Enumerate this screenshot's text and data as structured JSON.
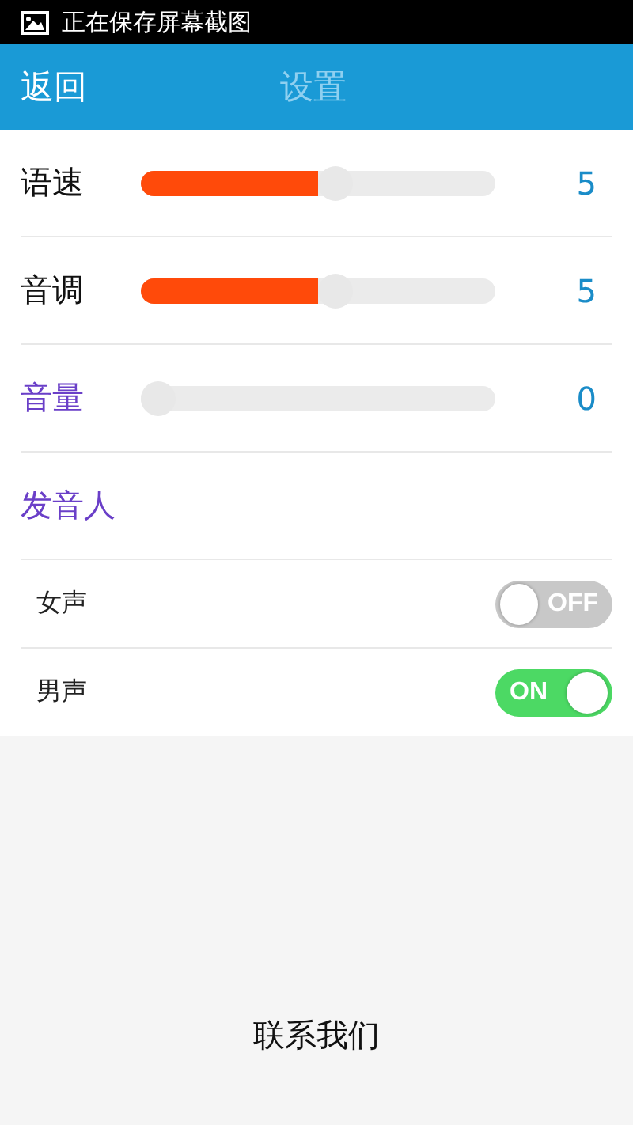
{
  "status_bar": {
    "notification": "正在保存屏幕截图"
  },
  "header": {
    "back": "返回",
    "title": "设置"
  },
  "sliders": [
    {
      "label": "语速",
      "highlighted": false,
      "level": 0.555,
      "reading": "5"
    },
    {
      "label": "音调",
      "highlighted": false,
      "level": 0.555,
      "reading": "5"
    },
    {
      "label": "音量",
      "highlighted": true,
      "level": 0,
      "reading": "0"
    }
  ],
  "speaker_section": {
    "title": "发音人",
    "options": [
      {
        "label": "女声",
        "on": false,
        "switch_text": "OFF"
      },
      {
        "label": "男声",
        "on": true,
        "switch_text": "ON"
      }
    ]
  },
  "footer": {
    "link": "联系我们"
  }
}
